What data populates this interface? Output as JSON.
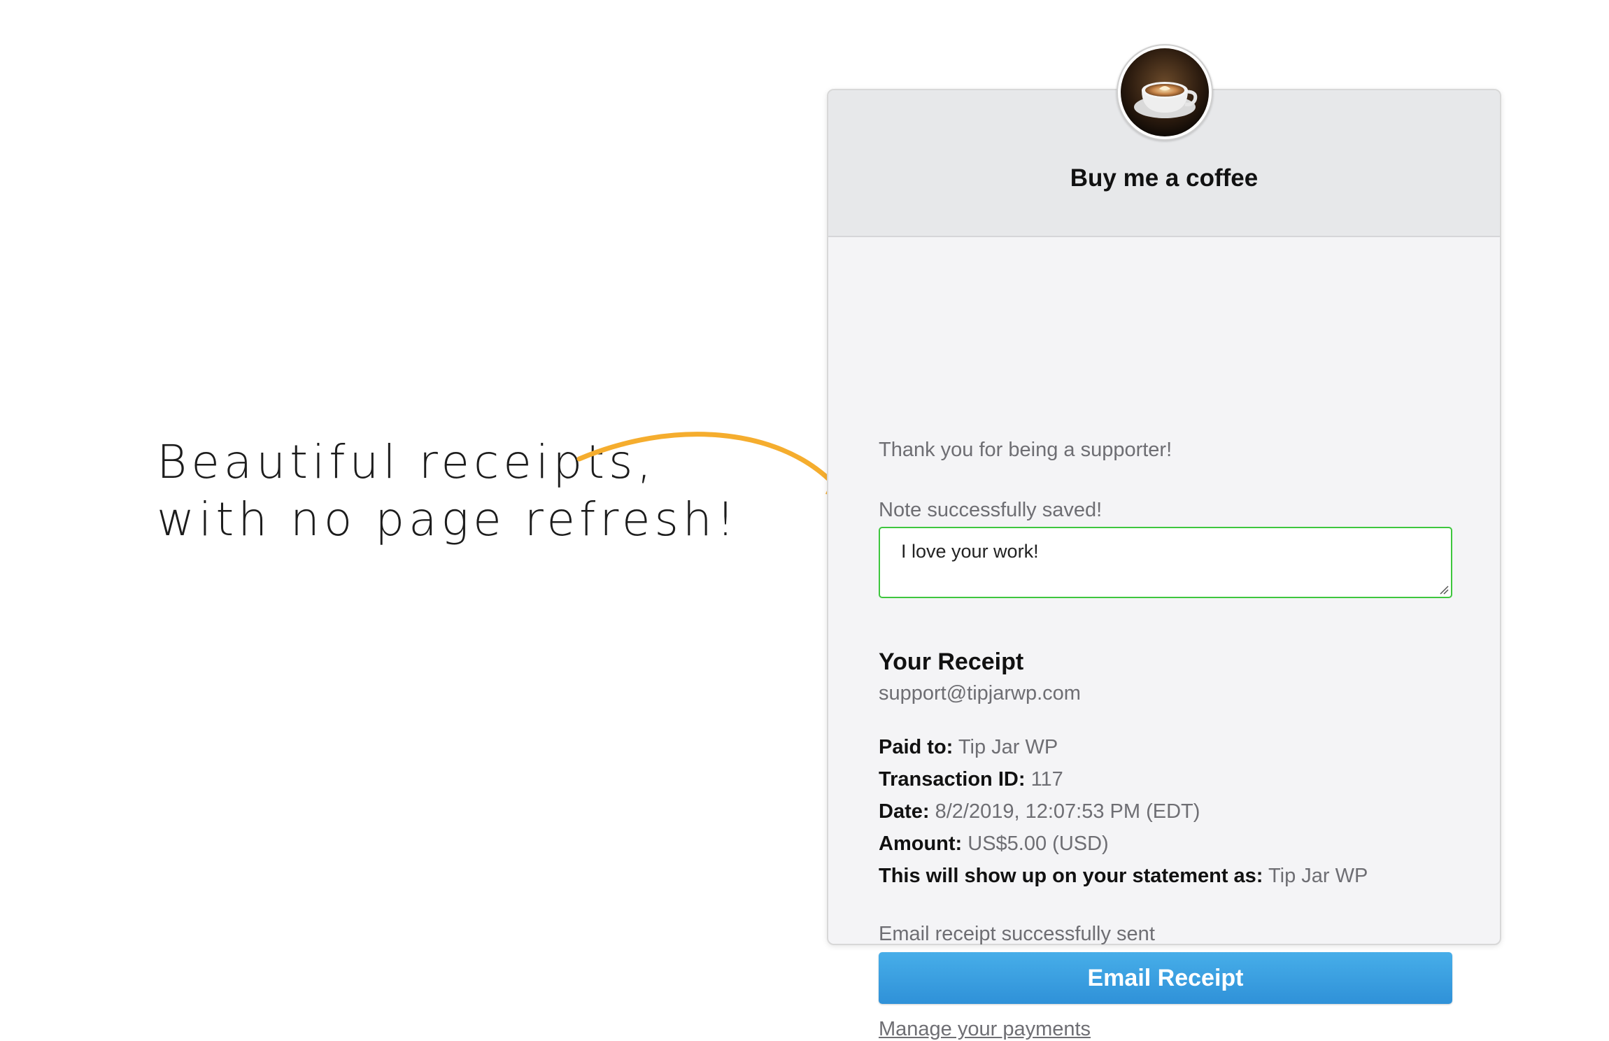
{
  "promo": {
    "line1": "Beautiful receipts,",
    "line2": "with no page refresh!",
    "arrow_color": "#f5ad2e"
  },
  "card": {
    "avatar_icon": "coffee-cup-icon",
    "title": "Buy me a coffee",
    "thanks": "Thank you for being a supporter!",
    "note_status": "Note successfully saved!",
    "note_value": "I love your work!",
    "receipt": {
      "title": "Your Receipt",
      "email": "support@tipjarwp.com",
      "paid_to_label": "Paid to:",
      "paid_to_value": "Tip Jar WP",
      "transaction_label": "Transaction ID:",
      "transaction_value": "117",
      "date_label": "Date:",
      "date_value": "8/2/2019, 12:07:53 PM (EDT)",
      "amount_label": "Amount:",
      "amount_value": "US$5.00 (USD)",
      "statement_label": "This will show up on your statement as:",
      "statement_value": "Tip Jar WP"
    },
    "email_status": "Email receipt successfully sent",
    "email_button": "Email Receipt",
    "manage_link": "Manage your payments"
  },
  "colors": {
    "note_border": "#3ec63e",
    "button": "#3a9fe0",
    "header_bg": "#e7e8ea",
    "card_bg": "#f4f4f6"
  }
}
